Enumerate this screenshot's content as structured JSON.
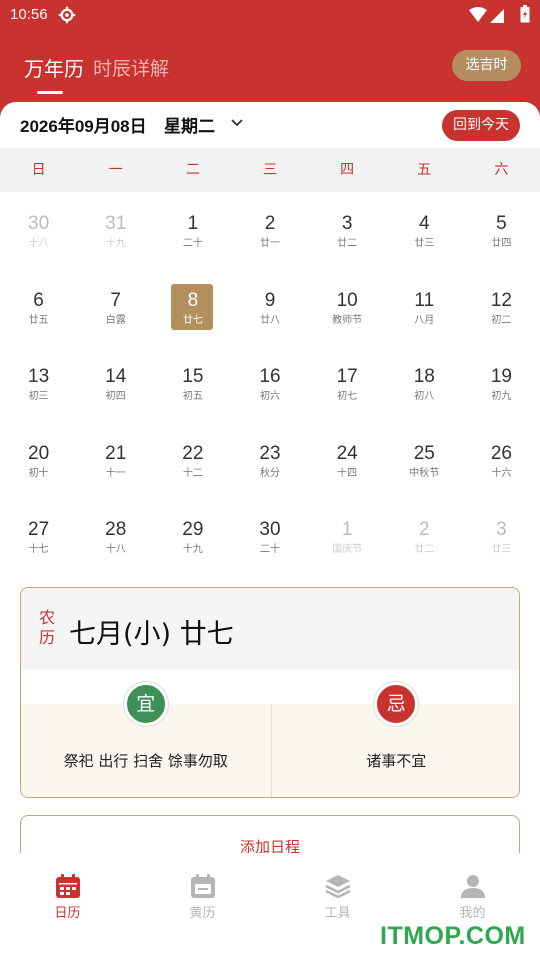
{
  "status_bar": {
    "time": "10:56"
  },
  "header": {
    "tab_active": "万年历",
    "tab_other": "时辰详解",
    "pick_button": "选吉时"
  },
  "date_bar": {
    "date": "2026年09月08日",
    "weekday": "星期二",
    "today_button": "回到今天"
  },
  "weekdays": [
    "日",
    "一",
    "二",
    "三",
    "四",
    "五",
    "六"
  ],
  "calendar": [
    [
      {
        "d": "30",
        "l": "十八",
        "dim": true
      },
      {
        "d": "31",
        "l": "十九",
        "dim": true
      },
      {
        "d": "1",
        "l": "二十"
      },
      {
        "d": "2",
        "l": "廿一"
      },
      {
        "d": "3",
        "l": "廿二"
      },
      {
        "d": "4",
        "l": "廿三"
      },
      {
        "d": "5",
        "l": "廿四"
      }
    ],
    [
      {
        "d": "6",
        "l": "廿五"
      },
      {
        "d": "7",
        "l": "白露"
      },
      {
        "d": "8",
        "l": "廿七",
        "selected": true
      },
      {
        "d": "9",
        "l": "廿八"
      },
      {
        "d": "10",
        "l": "教师节"
      },
      {
        "d": "11",
        "l": "八月"
      },
      {
        "d": "12",
        "l": "初二"
      }
    ],
    [
      {
        "d": "13",
        "l": "初三"
      },
      {
        "d": "14",
        "l": "初四"
      },
      {
        "d": "15",
        "l": "初五"
      },
      {
        "d": "16",
        "l": "初六"
      },
      {
        "d": "17",
        "l": "初七"
      },
      {
        "d": "18",
        "l": "初八"
      },
      {
        "d": "19",
        "l": "初九"
      }
    ],
    [
      {
        "d": "20",
        "l": "初十"
      },
      {
        "d": "21",
        "l": "十一"
      },
      {
        "d": "22",
        "l": "十二"
      },
      {
        "d": "23",
        "l": "秋分"
      },
      {
        "d": "24",
        "l": "十四"
      },
      {
        "d": "25",
        "l": "中秋节"
      },
      {
        "d": "26",
        "l": "十六"
      }
    ],
    [
      {
        "d": "27",
        "l": "十七"
      },
      {
        "d": "28",
        "l": "十八"
      },
      {
        "d": "29",
        "l": "十九"
      },
      {
        "d": "30",
        "l": "二十"
      },
      {
        "d": "1",
        "l": "国庆节",
        "dim": true
      },
      {
        "d": "2",
        "l": "廿二",
        "dim": true
      },
      {
        "d": "3",
        "l": "廿三",
        "dim": true
      }
    ]
  ],
  "lunar": {
    "tag": "农历",
    "date": "七月(小) 廿七",
    "yi_label": "宜",
    "yi_text": "祭祀 出行 扫舍 馀事勿取",
    "ji_label": "忌",
    "ji_text": "诸事不宜"
  },
  "add_schedule": "添加日程",
  "nav": [
    {
      "label": "日历",
      "icon": "calendar-icon",
      "active": true
    },
    {
      "label": "黄历",
      "icon": "almanac-icon"
    },
    {
      "label": "工具",
      "icon": "layers-icon"
    },
    {
      "label": "我的",
      "icon": "user-icon"
    }
  ],
  "watermark": "ITMOP.COM",
  "colors": {
    "primary": "#c8322f",
    "gold": "#b4905e",
    "good": "#3f8f58"
  }
}
